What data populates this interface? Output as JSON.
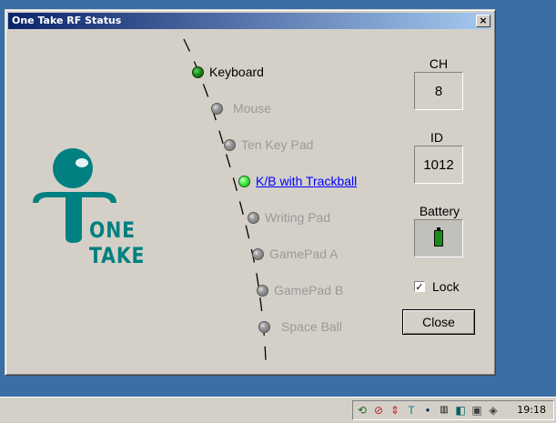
{
  "window": {
    "title": "One Take RF Status",
    "close_glyph": "×"
  },
  "logo": {
    "text": "ONE TAKE",
    "color": "#008080"
  },
  "devices": [
    {
      "label": "Keyboard",
      "state": "connected"
    },
    {
      "label": "Mouse",
      "state": "inactive"
    },
    {
      "label": "Ten Key Pad",
      "state": "inactive"
    },
    {
      "label": "K/B with Trackball",
      "state": "active"
    },
    {
      "label": "Writing Pad",
      "state": "inactive"
    },
    {
      "label": "GamePad A",
      "state": "inactive"
    },
    {
      "label": "GamePad B",
      "state": "inactive"
    },
    {
      "label": "Space Ball",
      "state": "inactive"
    }
  ],
  "status": {
    "ch_label": "CH",
    "ch_value": "8",
    "id_label": "ID",
    "id_value": "1012",
    "battery_label": "Battery",
    "battery_icon": "battery-full-icon",
    "lock_label": "Lock",
    "lock_checked": true,
    "close_button": "Close"
  },
  "taskbar": {
    "clock": "19:18",
    "tray_icons": [
      "network-icon",
      "sound-icon",
      "updown-icon",
      "onetake-icon",
      "dot-icon",
      "keyboard-icon",
      "device-icon",
      "device2-icon",
      "volume-icon"
    ]
  },
  "colors": {
    "desktop": "#3a6ea5",
    "title_start": "#0a246a",
    "title_end": "#a6caf0",
    "active_link": "#0000ff",
    "led_green": "#3ef03e"
  }
}
